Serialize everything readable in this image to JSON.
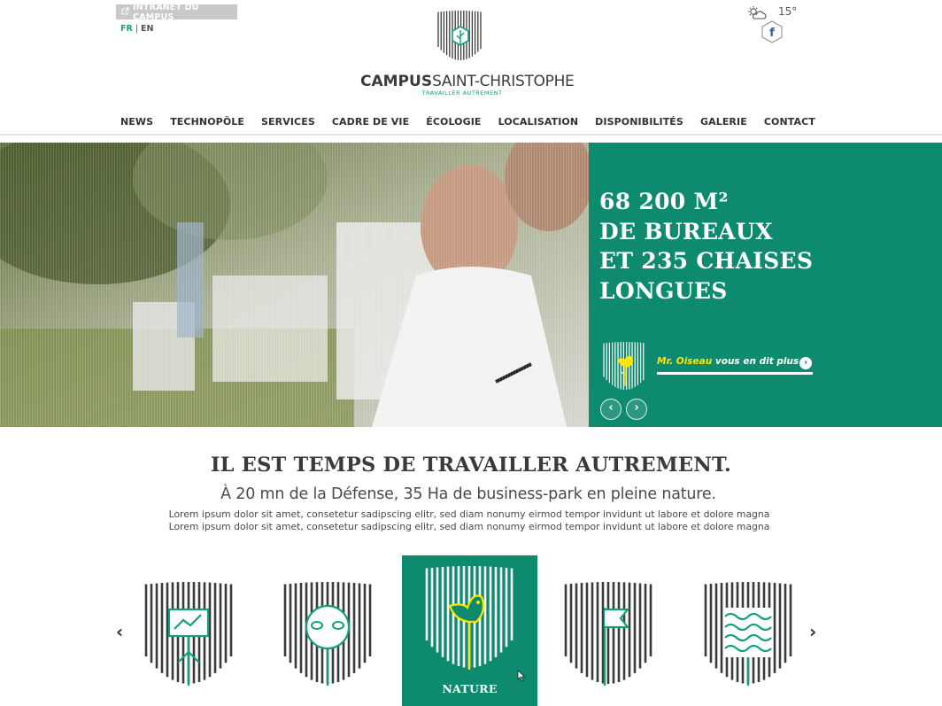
{
  "header": {
    "intranet_label": "INTRANET DU CAMPUS",
    "lang_fr": "FR",
    "lang_separator": "|",
    "lang_en": "EN",
    "brand_bold": "CAMPUS",
    "brand_rest": "SAINT-CHRISTOPHE",
    "tagline": "TRAVAILLER AUTREMENT",
    "temperature": "15°",
    "weather_icon": "partly-cloudy-icon",
    "social_icon": "facebook-icon"
  },
  "nav": {
    "items": [
      "NEWS",
      "TECHNOPÔLE",
      "SERVICES",
      "CADRE DE VIE",
      "ÉCOLOGIE",
      "LOCALISATION",
      "DISPONIBILITÉS",
      "GALERIE",
      "CONTACT"
    ]
  },
  "hero": {
    "title_lines": [
      "68 200 M²",
      "DE BUREAUX",
      "ET 235 CHAISES",
      "LONGUES"
    ],
    "oiseau_name": "Mr. Oiseau",
    "oiseau_text": " vous en dit plus",
    "prev_symbol": "‹",
    "next_symbol": "›"
  },
  "intro": {
    "headline": "IL EST TEMPS DE TRAVAILLER AUTREMENT.",
    "subhead": "À 20 mn de la Défense, 35 Ha de business-park en pleine nature.",
    "lorem": "Lorem ipsum dolor sit amet, consetetur sadipscing elitr, sed diam nonumy eirmod tempor invidunt ut labore et dolore magna  Lorem ipsum dolor sit amet, consetetur sadipscing elitr, sed diam nonumy eirmod tempor invidunt ut labore et dolore magna"
  },
  "carousel": {
    "prev_symbol": "‹",
    "next_symbol": "›",
    "active_label": "NATURE",
    "icons": [
      "presentation-board-icon",
      "sheep-icon",
      "bird-icon",
      "flag-icon",
      "waves-icon"
    ]
  },
  "colors": {
    "brand_green": "#0e8a6e",
    "accent_yellow": "#ffe600",
    "dark_grey": "#3a3a3a"
  }
}
